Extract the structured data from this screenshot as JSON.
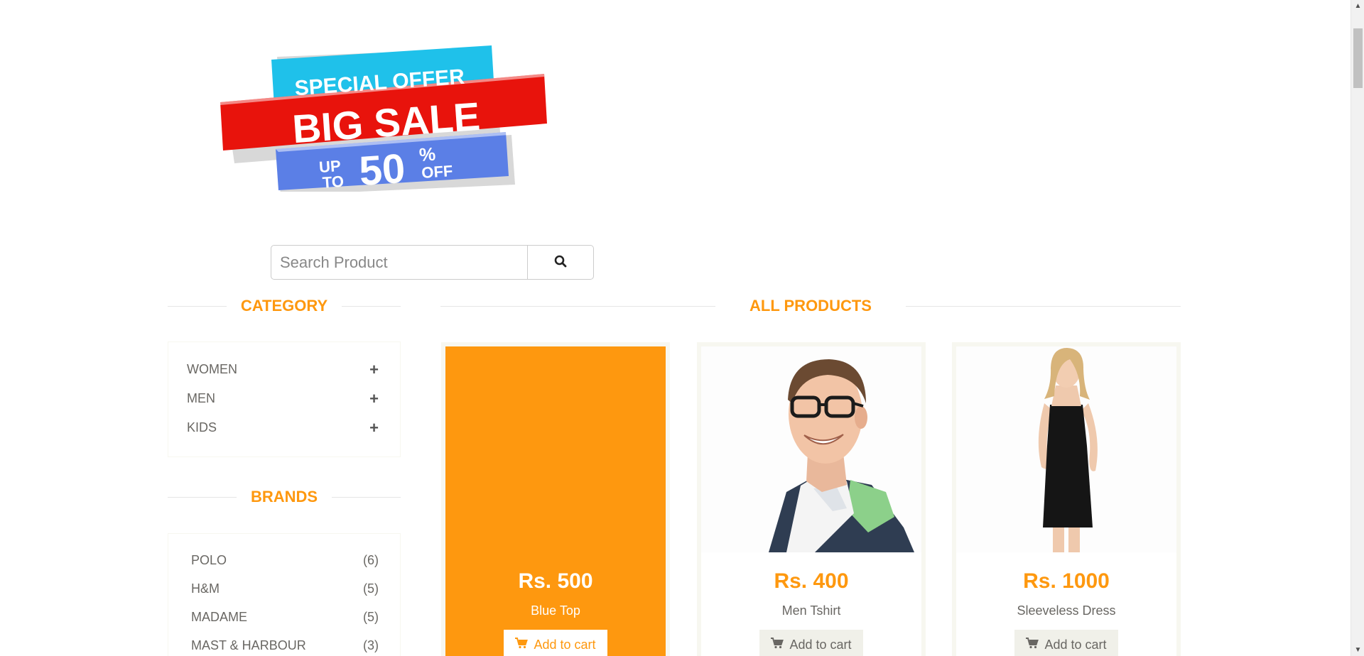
{
  "banner": {
    "line1": "SPECIAL OFFER",
    "line2": "BIG SALE",
    "up": "UP",
    "to": "TO",
    "percent": "50",
    "pct_sign": "%",
    "off": "OFF"
  },
  "search": {
    "placeholder": "Search Product"
  },
  "sidebar": {
    "category_title": "CATEGORY",
    "categories": [
      {
        "label": "WOMEN",
        "icon": "+"
      },
      {
        "label": "MEN",
        "icon": "+"
      },
      {
        "label": "KIDS",
        "icon": "+"
      }
    ],
    "brands_title": "BRANDS",
    "brands": [
      {
        "label": "POLO",
        "count": "(6)"
      },
      {
        "label": "H&M",
        "count": "(5)"
      },
      {
        "label": "MADAME",
        "count": "(5)"
      },
      {
        "label": "MAST & HARBOUR",
        "count": "(3)"
      }
    ]
  },
  "main": {
    "title": "ALL PRODUCTS",
    "products": [
      {
        "price": "Rs. 500",
        "name": "Blue Top",
        "cart_label": "Add to cart"
      },
      {
        "price": "Rs. 400",
        "name": "Men Tshirt",
        "cart_label": "Add to cart"
      },
      {
        "price": "Rs. 1000",
        "name": "Sleeveless Dress",
        "cart_label": "Add to cart"
      }
    ]
  },
  "colors": {
    "accent": "#fe980f",
    "text": "#696763",
    "panel_border": "#f7f7f0"
  }
}
